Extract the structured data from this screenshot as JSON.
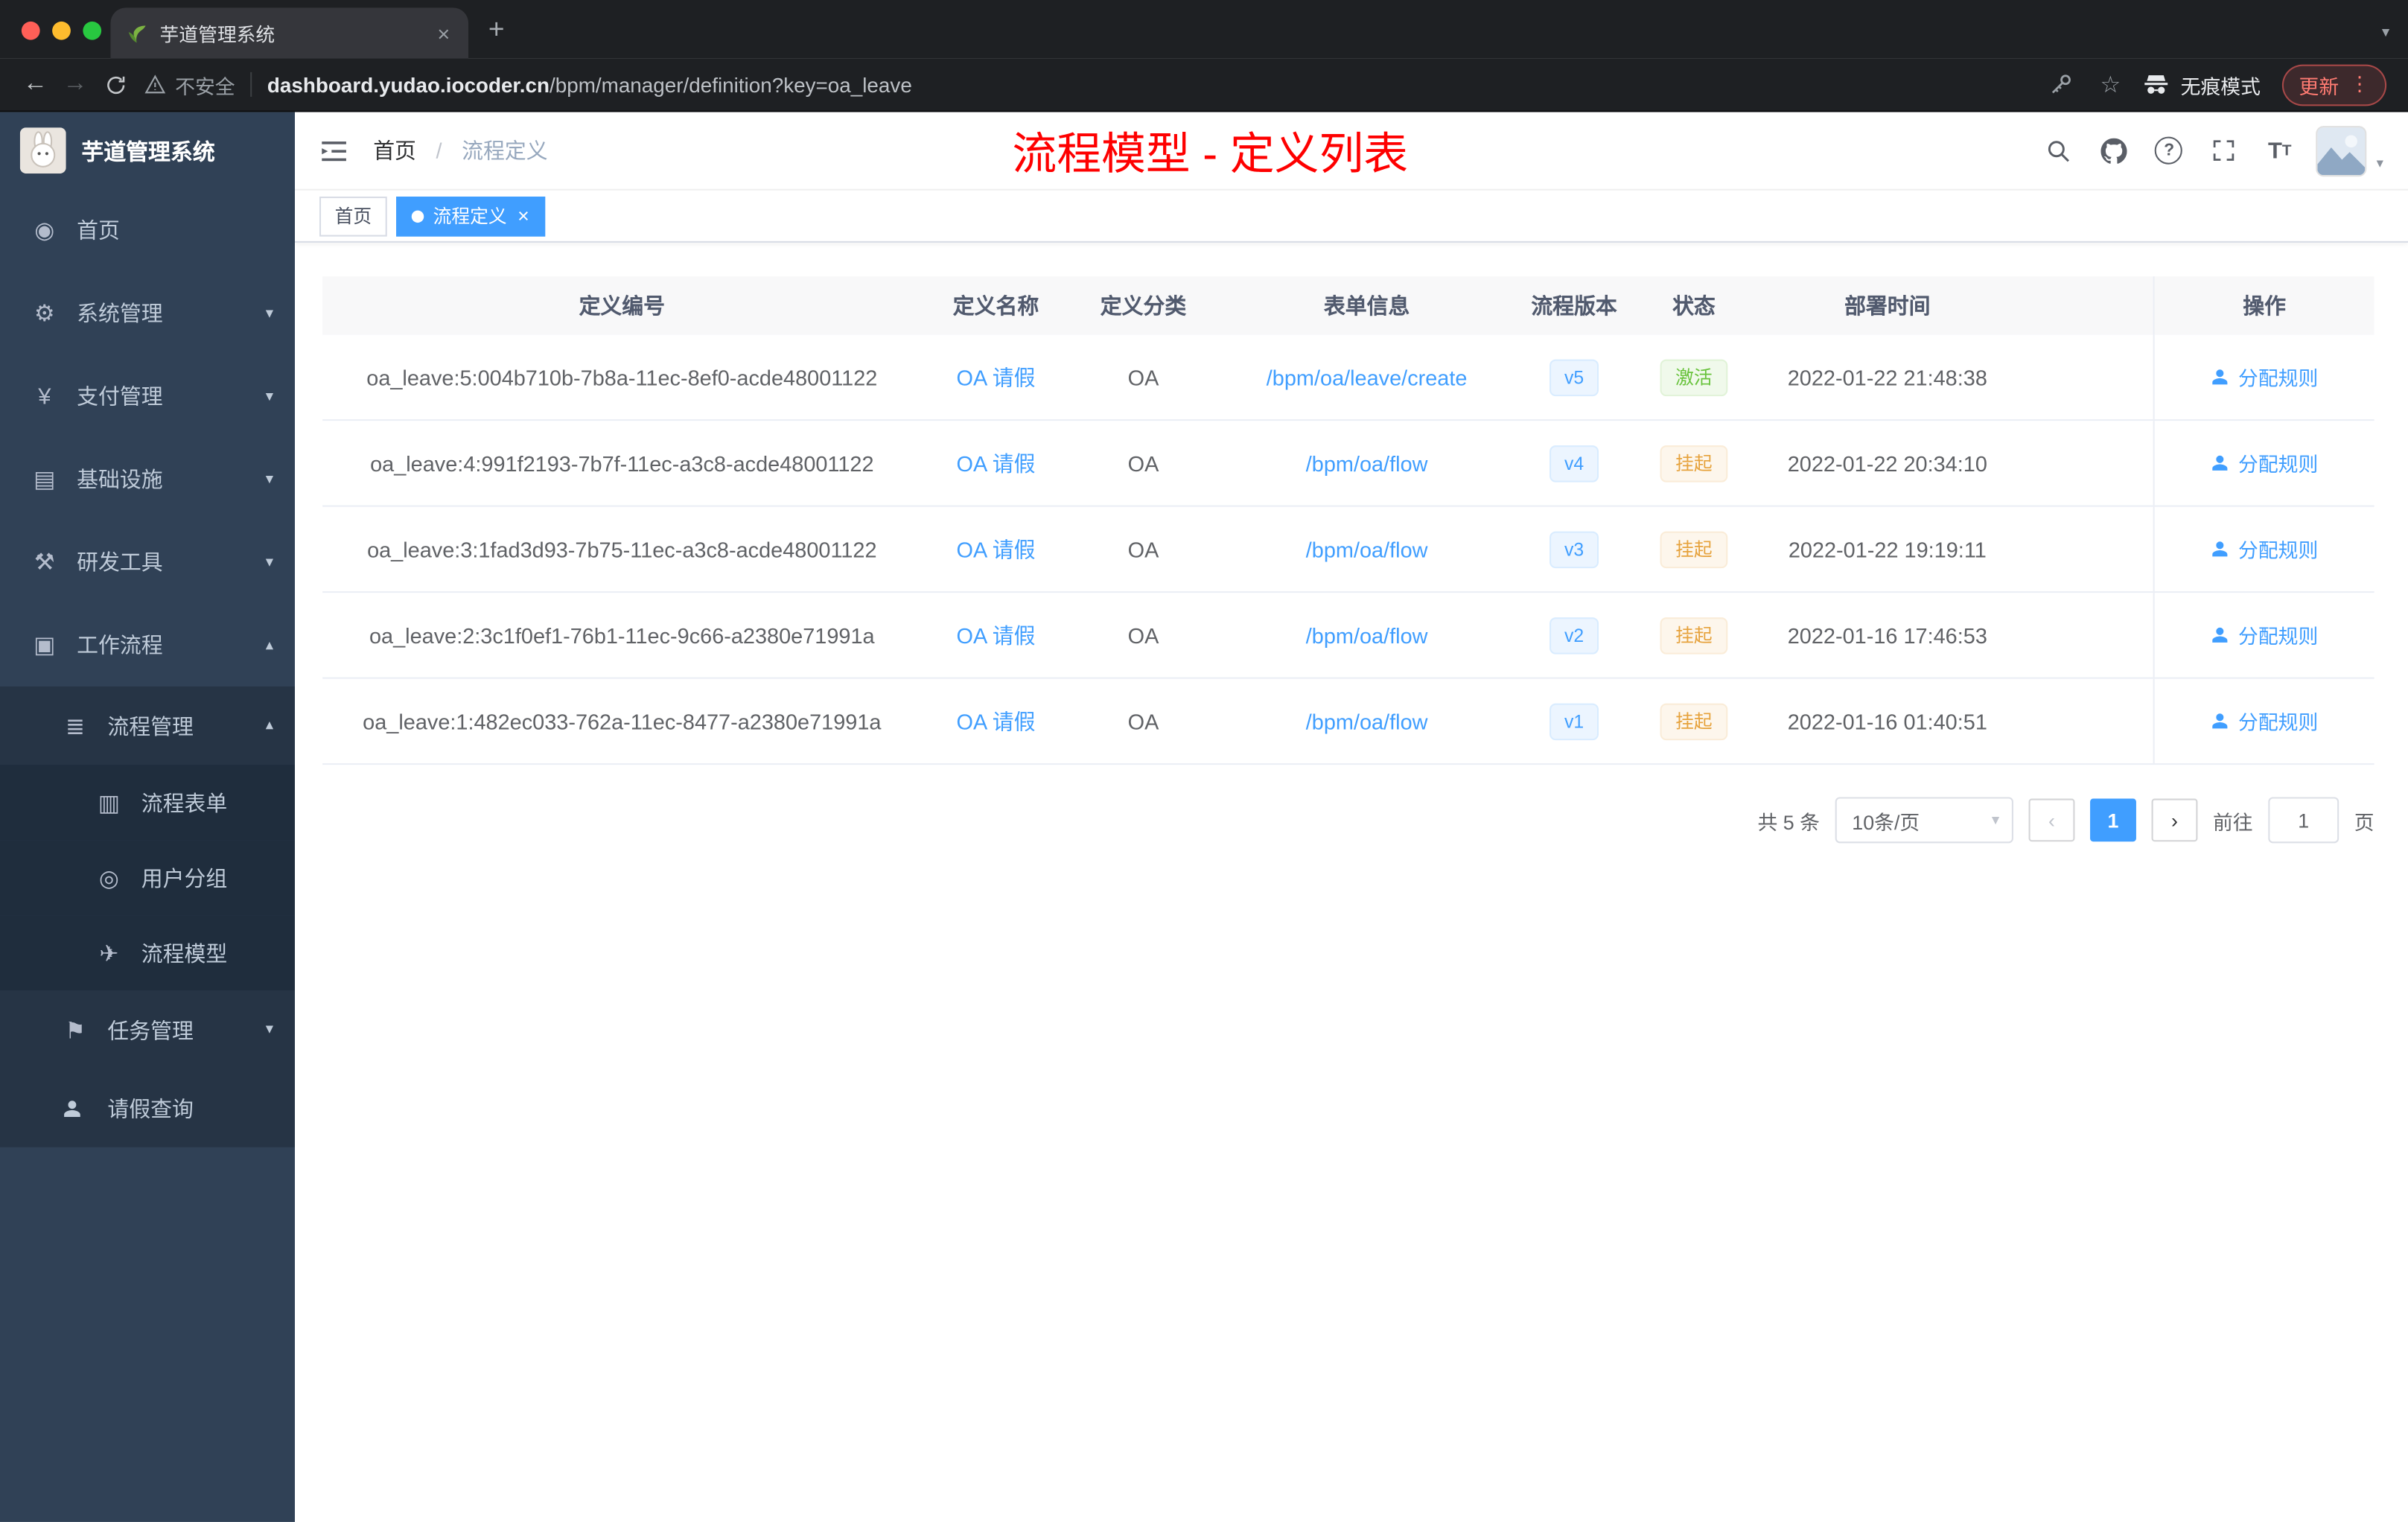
{
  "colors": {
    "accent": "#409eff",
    "success": "#67c23a",
    "warning": "#e6a23c",
    "annotation": "#fe0000",
    "sidebar_bg": "#304156"
  },
  "browser": {
    "tab_title": "芋道管理系统",
    "new_tab": "+",
    "close": "×",
    "back": "←",
    "forward": "→",
    "security_label": "不安全",
    "url_host": "dashboard.yudao.iocoder.cn",
    "url_rest": "/bpm/manager/definition?key=oa_leave",
    "incognito_label": "无痕模式",
    "update_label": "更新",
    "menu_dots": "⋮",
    "bookmark_star": "☆"
  },
  "icons": {
    "dashboard": "◉",
    "gear": "⚙",
    "yen": "¥",
    "infra": "▤",
    "tools": "⚒",
    "workflow": "▣",
    "process_mgmt": "≣",
    "form": "▥",
    "user_group": "◎",
    "model": "✈",
    "task": "⚑",
    "chevron_down": "▾",
    "chevron_up": "▴",
    "question": "?",
    "caret_down": "▾"
  },
  "sidebar": {
    "app_title": "芋道管理系统",
    "items": [
      {
        "label": "首页"
      },
      {
        "label": "系统管理"
      },
      {
        "label": "支付管理"
      },
      {
        "label": "基础设施"
      },
      {
        "label": "研发工具"
      },
      {
        "label": "工作流程"
      },
      {
        "label": "流程管理"
      },
      {
        "label": "流程表单"
      },
      {
        "label": "用户分组"
      },
      {
        "label": "流程模型"
      },
      {
        "label": "任务管理"
      },
      {
        "label": "请假查询"
      }
    ]
  },
  "header": {
    "breadcrumb_home": "首页",
    "breadcrumb_sep": "/",
    "breadcrumb_current": "流程定义",
    "annotation": "流程模型 - 定义列表"
  },
  "tags": {
    "home": "首页",
    "active": "流程定义",
    "close": "×"
  },
  "table": {
    "columns": [
      "定义编号",
      "定义名称",
      "定义分类",
      "表单信息",
      "流程版本",
      "状态",
      "部署时间",
      "操作"
    ],
    "rows": [
      {
        "id": "oa_leave:5:004b710b-7b8a-11ec-8ef0-acde48001122",
        "name": "OA 请假",
        "category": "OA",
        "form": "/bpm/oa/leave/create",
        "version": "v5",
        "status": "激活",
        "status_type": "success",
        "deployed": "2022-01-22 21:48:38",
        "action": "分配规则"
      },
      {
        "id": "oa_leave:4:991f2193-7b7f-11ec-a3c8-acde48001122",
        "name": "OA 请假",
        "category": "OA",
        "form": "/bpm/oa/flow",
        "version": "v4",
        "status": "挂起",
        "status_type": "warning",
        "deployed": "2022-01-22 20:34:10",
        "action": "分配规则"
      },
      {
        "id": "oa_leave:3:1fad3d93-7b75-11ec-a3c8-acde48001122",
        "name": "OA 请假",
        "category": "OA",
        "form": "/bpm/oa/flow",
        "version": "v3",
        "status": "挂起",
        "status_type": "warning",
        "deployed": "2022-01-22 19:19:11",
        "action": "分配规则"
      },
      {
        "id": "oa_leave:2:3c1f0ef1-76b1-11ec-9c66-a2380e71991a",
        "name": "OA 请假",
        "category": "OA",
        "form": "/bpm/oa/flow",
        "version": "v2",
        "status": "挂起",
        "status_type": "warning",
        "deployed": "2022-01-16 17:46:53",
        "action": "分配规则"
      },
      {
        "id": "oa_leave:1:482ec033-762a-11ec-8477-a2380e71991a",
        "name": "OA 请假",
        "category": "OA",
        "form": "/bpm/oa/flow",
        "version": "v1",
        "status": "挂起",
        "status_type": "warning",
        "deployed": "2022-01-16 01:40:51",
        "action": "分配规则"
      }
    ]
  },
  "pagination": {
    "total": "共 5 条",
    "page_size": "10条/页",
    "prev": "‹",
    "page": "1",
    "next": "›",
    "goto": "前往",
    "goto_value": "1",
    "unit": "页"
  }
}
